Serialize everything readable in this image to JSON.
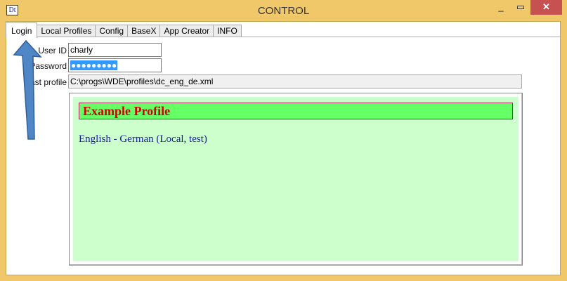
{
  "window": {
    "title": "CONTROL",
    "icon_text": "Dt",
    "minimize": "_",
    "maximize": "▭",
    "close": "✕"
  },
  "tabs": [
    {
      "label": "Login"
    },
    {
      "label": "Local Profiles"
    },
    {
      "label": "Config"
    },
    {
      "label": "BaseX"
    },
    {
      "label": "App Creator"
    },
    {
      "label": "INFO"
    }
  ],
  "login": {
    "user_id_label": "User ID",
    "user_id_value": "charly",
    "password_label": "Password",
    "password_value": "●●●●●●●●●",
    "last_profile_label": "Last profile",
    "last_profile_value": "C:\\progs\\WDE\\profiles\\dc_eng_de.xml"
  },
  "profile": {
    "title": "Example Profile",
    "description": "English - German (Local, test)"
  }
}
